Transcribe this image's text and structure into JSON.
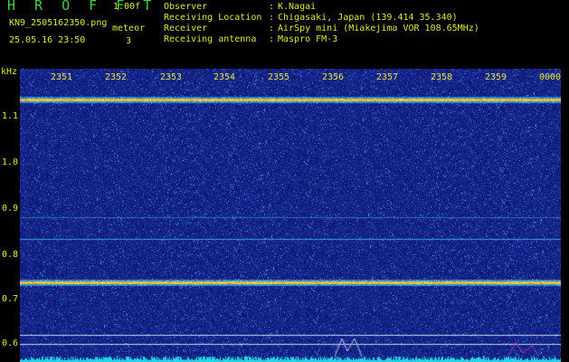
{
  "header": {
    "app_title": "H R O F F T",
    "version": "1.00f",
    "filename": "KN9_2505162350.png",
    "meteor_label": "meteor",
    "meteor_count": "3",
    "datetime": "25.05.16 23:50",
    "info": [
      {
        "key": "Observer",
        "value": "K.Nagai"
      },
      {
        "key": "Receiving Location",
        "value": "Chigasaki, Japan (139.414 35.340)"
      },
      {
        "key": "Receiver",
        "value": "AirSpy mini (Miakejima VOR 108.65MHz)"
      },
      {
        "key": "Receiving antenna",
        "value": "Maspro FM-3"
      }
    ]
  },
  "spectrogram": {
    "y_unit": "kHz",
    "y_ticks": [
      "1.1",
      "1.0",
      "0.9",
      "0.8",
      "0.7",
      "0.6"
    ],
    "x_ticks": [
      "2351",
      "2352",
      "2353",
      "2354",
      "2355",
      "2356",
      "2357",
      "2358",
      "2359",
      "0000"
    ],
    "colors": {
      "background": "#0d1673",
      "signal": "#f0a030",
      "trace": "#1ed7e6",
      "peak": "#b03aa8"
    }
  }
}
